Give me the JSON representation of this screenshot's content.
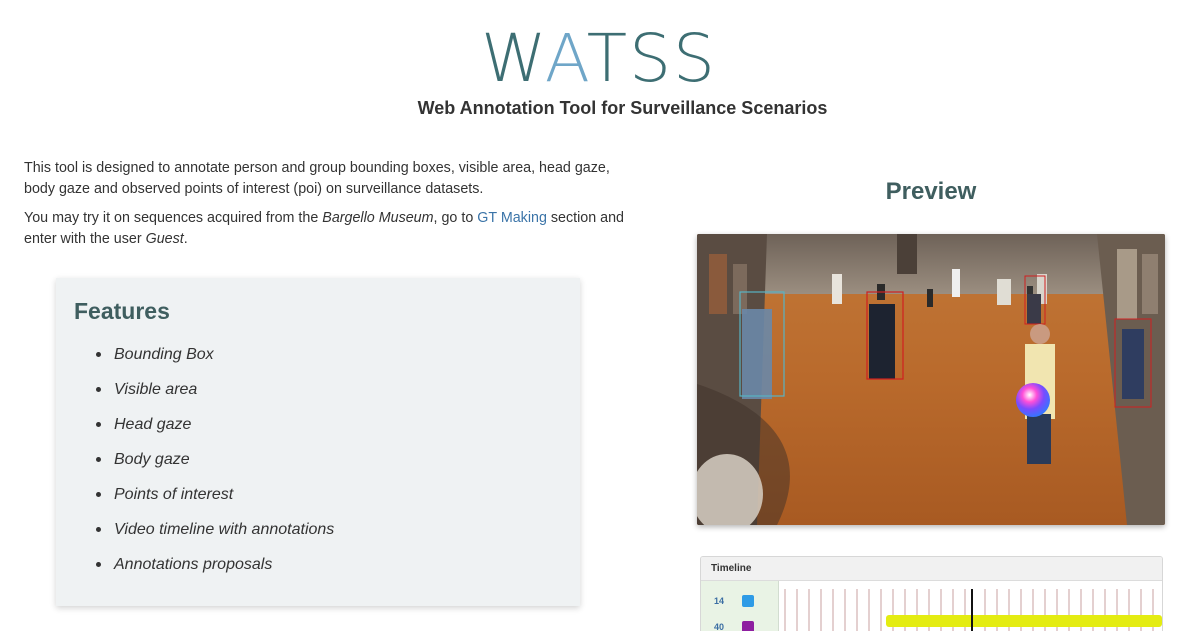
{
  "header": {
    "logo_pre": "W",
    "logo_accent": "A",
    "logo_post": "TSS",
    "subtitle": "Web Annotation Tool for Surveillance Scenarios"
  },
  "intro": {
    "p1": "This tool is designed to annotate person and group bounding boxes, visible area, head gaze, body gaze and observed points of interest (poi) on surveillance datasets.",
    "p2_a": "You may try it on sequences acquired from the ",
    "p2_museum": "Bargello Museum",
    "p2_b": ", go to ",
    "p2_link": "GT Making",
    "p2_c": " section and enter with the user ",
    "p2_user": "Guest",
    "p2_d": "."
  },
  "features": {
    "title": "Features",
    "items": [
      "Bounding Box",
      "Visible area",
      "Head gaze",
      "Body gaze",
      "Points of interest",
      "Video timeline with annotations",
      "Annotations proposals"
    ]
  },
  "preview": {
    "title": "Preview"
  },
  "timeline": {
    "header": "Timeline",
    "rows": [
      {
        "id": "14",
        "color": "#2e9be6"
      },
      {
        "id": "40",
        "color": "#8e1fa0"
      }
    ]
  },
  "colors": {
    "accent": "#3d6e73",
    "link": "#3b74a8",
    "heading": "#3f5e5f",
    "track": "#e4ec12",
    "marker": "#8b1a10"
  }
}
